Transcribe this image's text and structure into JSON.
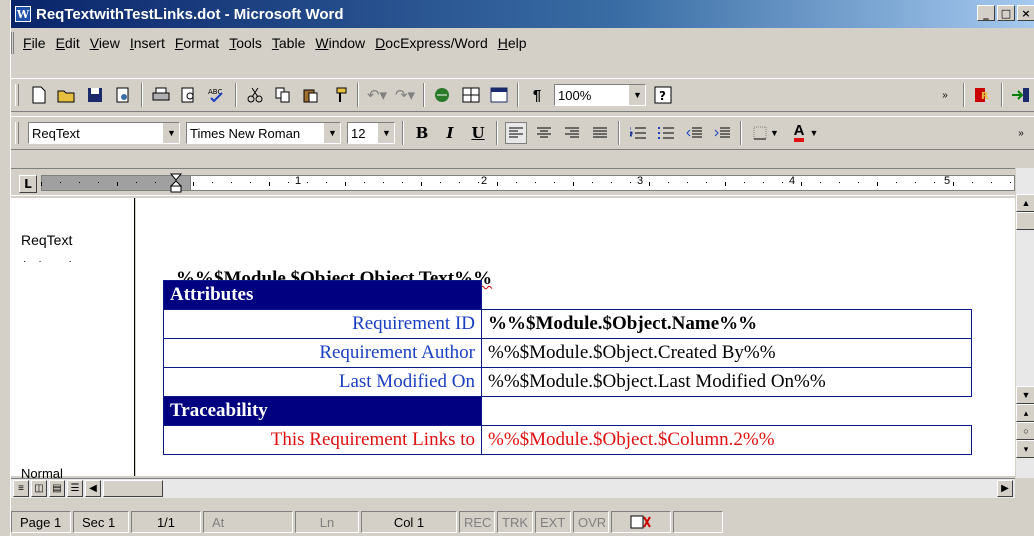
{
  "window": {
    "title": "ReqTextwithTestLinks.dot - Microsoft Word",
    "app_icon_letter": "W",
    "minimize": "_",
    "restore": "□",
    "close": "×"
  },
  "menu": [
    "File",
    "Edit",
    "View",
    "Insert",
    "Format",
    "Tools",
    "Table",
    "Window",
    "DocExpress/Word",
    "Help"
  ],
  "toolbar1": {
    "zoom_value": "100%",
    "icons": [
      "new-icon",
      "open-icon",
      "save-icon",
      "permission-icon",
      "print-icon",
      "print-preview-icon",
      "spelling-icon",
      "cut-icon",
      "copy-icon",
      "paste-icon",
      "format-painter-icon",
      "undo-icon",
      "redo-icon",
      "hyperlink-icon",
      "tables-borders-icon",
      "insert-table-icon",
      "show-formatting-icon",
      "help-icon",
      "more-icon",
      "docexpress-icon",
      "docexpress-exit-icon"
    ]
  },
  "toolbar2": {
    "style_value": "ReqText",
    "font_value": "Times New Roman",
    "size_value": "12",
    "bold": "B",
    "italic": "I",
    "underline": "U",
    "font_color_label": "A"
  },
  "ruler": {
    "numbers": [
      "1",
      "2",
      "3",
      "4",
      "5"
    ]
  },
  "style_area": {
    "style_top": "ReqText",
    "style_bottom": "Normal"
  },
  "document": {
    "heading": "%%$Module.$Object.Object Text%%",
    "rows": [
      {
        "label": "Attributes",
        "value": "",
        "type": "header"
      },
      {
        "label": "Requirement ID",
        "value": "%%$Module.$Object.Name%%",
        "type": "bold"
      },
      {
        "label": "Requirement Author",
        "value": "%%$Module.$Object.Created By%%",
        "type": "normal"
      },
      {
        "label": "Last Modified On",
        "value": "%%$Module.$Object.Last Modified On%%",
        "type": "normal"
      },
      {
        "label": "Traceability",
        "value": "",
        "type": "header"
      },
      {
        "label": "This Requirement Links to",
        "value": "%%$Module.$Object.$Column.2%%",
        "type": "red"
      }
    ]
  },
  "statusbar": {
    "page": "Page 1",
    "sec": "Sec 1",
    "pages": "1/1",
    "at": "At",
    "ln": "Ln",
    "col": "Col 1",
    "rec": "REC",
    "trk": "TRK",
    "ext": "EXT",
    "ovr": "OVR"
  },
  "colors": {
    "title_bar": "#0a246a",
    "table_header": "#000080",
    "label_blue": "#1a3ec0",
    "link_red": "#e01010"
  }
}
